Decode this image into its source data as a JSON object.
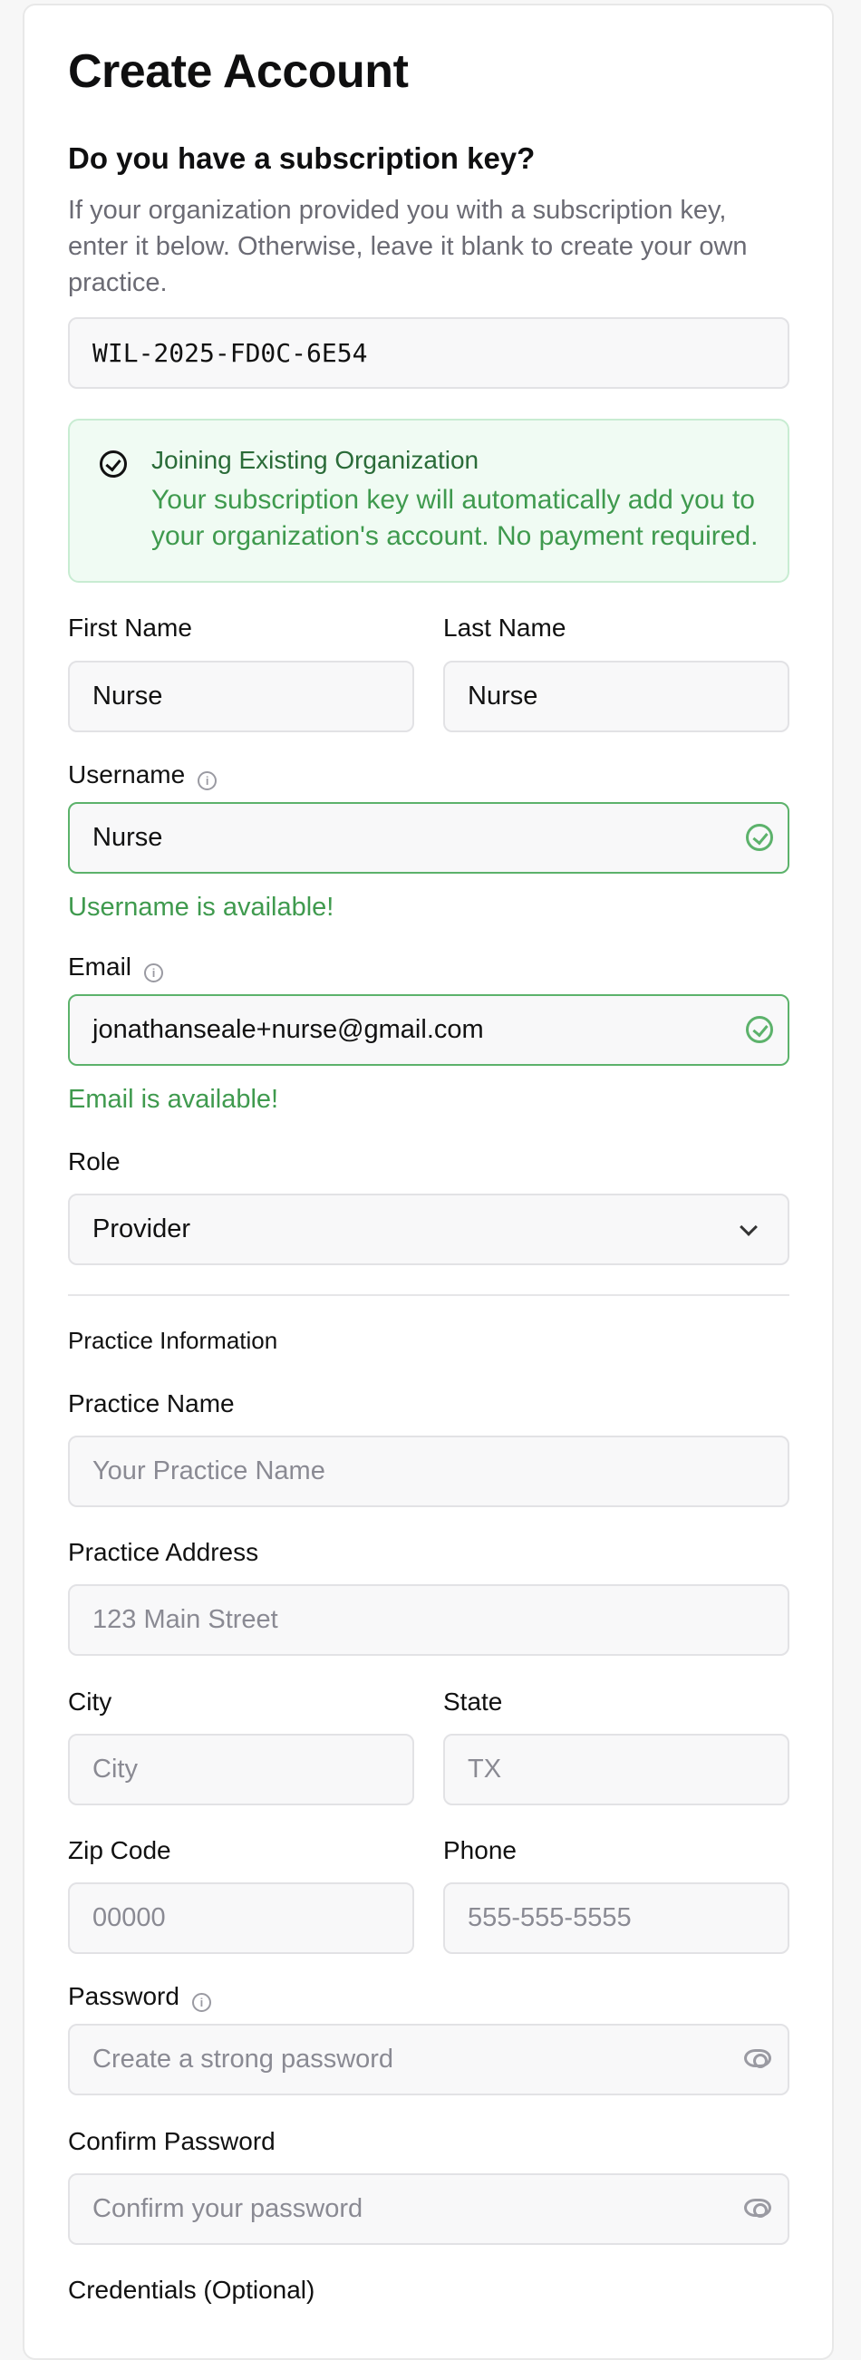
{
  "form": {
    "title": "Create Account",
    "subscription": {
      "heading": "Do you have a subscription key?",
      "description": "If your organization provided you with a subscription key, enter it below. Otherwise, leave it blank to create your own practice.",
      "key_value": "WIL-2025-FD0C-6E54"
    },
    "banner": {
      "title": "Joining Existing Organization",
      "text": "Your subscription key will automatically add you to your organization's account. No payment required.",
      "icon": "check-circle-icon"
    },
    "first_name": {
      "label": "First Name",
      "value": "Nurse"
    },
    "last_name": {
      "label": "Last Name",
      "value": "Nurse"
    },
    "username": {
      "label": "Username",
      "value": "Nurse",
      "status": "Username is available!"
    },
    "email": {
      "label": "Email",
      "value": "jonathanseale+nurse@gmail.com",
      "status": "Email is available!"
    },
    "role": {
      "label": "Role",
      "value": "Provider"
    },
    "practice": {
      "section_title": "Practice Information",
      "name": {
        "label": "Practice Name",
        "placeholder": "Your Practice Name"
      },
      "address": {
        "label": "Practice Address",
        "placeholder": "123 Main Street"
      },
      "city": {
        "label": "City",
        "placeholder": "City"
      },
      "state": {
        "label": "State",
        "placeholder": "TX"
      },
      "zip": {
        "label": "Zip Code",
        "placeholder": "00000"
      },
      "phone": {
        "label": "Phone",
        "placeholder": "555-555-5555"
      }
    },
    "password": {
      "label": "Password",
      "placeholder": "Create a strong password"
    },
    "confirm_password": {
      "label": "Confirm Password",
      "placeholder": "Confirm your password"
    },
    "credentials": {
      "label": "Credentials (Optional)"
    }
  },
  "colors": {
    "success": "#3f9a4e",
    "success_border": "#5cb26b",
    "banner_bg": "#f0fbf3",
    "muted_text": "#6b6b74"
  }
}
